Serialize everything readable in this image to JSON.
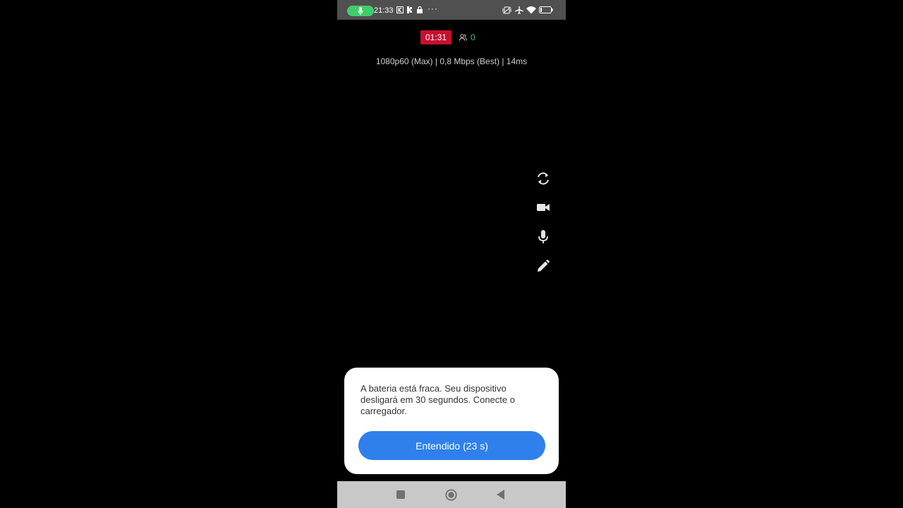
{
  "status_bar": {
    "time": "21:33",
    "dots": "···",
    "icons": [
      "microphone-icon",
      "kick-app-icon",
      "kick-k-icon",
      "lock-icon",
      "more-dots-icon",
      "vibrate-icon",
      "airplane-icon",
      "wifi-icon",
      "battery-icon"
    ]
  },
  "stream": {
    "timer": "01:31",
    "viewers": "0",
    "info": "1080p60 (Max) | 0,8 Mbps (Best) | 14ms"
  },
  "side_controls": [
    "refresh-icon",
    "video-camera-icon",
    "microphone-icon",
    "pencil-icon"
  ],
  "dialog": {
    "message": "A bateria está fraca. Seu dispositivo desligará em 30 segundos. Conecte o carregador.",
    "button_label": "Entendido (23 s)"
  },
  "colors": {
    "accent": "#2f80ed",
    "live_red": "#c8102e",
    "viewers_green": "#3fc55a",
    "mic_green": "#3ecf6b"
  }
}
